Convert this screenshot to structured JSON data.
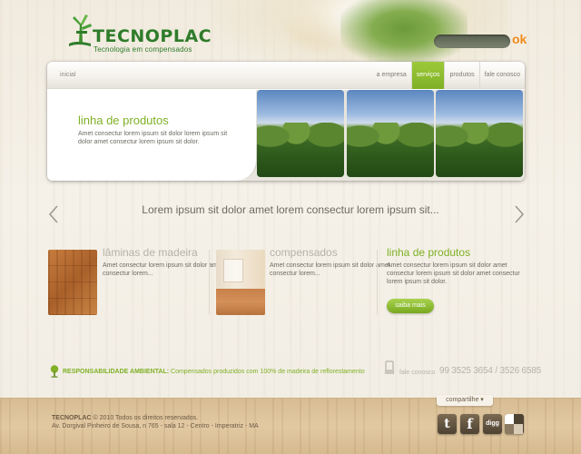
{
  "brand": {
    "name": "TECNOPLAC",
    "tagline": "Tecnologia em compensados"
  },
  "search": {
    "value": "",
    "placeholder": "",
    "button_label": "ok"
  },
  "nav": {
    "home": "inicial",
    "items": [
      {
        "label": "a empresa",
        "active": false
      },
      {
        "label": "serviços",
        "active": true
      },
      {
        "label": "produtos",
        "active": false
      },
      {
        "label": "fale conosco",
        "active": false
      }
    ]
  },
  "hero": {
    "title": "linha de produtos",
    "description": "Amet consectur lorem ipsum sit dolor lorem ipsum sit dolor amet consectur lorem ipsum sit dolor."
  },
  "tagline": "Lorem ipsum sit dolor amet lorem consectur lorem ipsum sit...",
  "columns": [
    {
      "title": "lâminas de madeira",
      "description": "Amet consectur lorem ipsum sit dolor amet consectur lorem..."
    },
    {
      "title": "compensados",
      "description": "Amet consectur lorem ipsum sit dolor amet consectur lorem..."
    },
    {
      "title": "linha de produtos",
      "description": "Amet consectur lorem ipsum sit dolor amet consectur lorem ipsum sit dolor amet consectur lorem ipsum sit dolor.",
      "button_label": "saiba mais"
    }
  ],
  "responsibility": {
    "label": "RESPONSABILIDADE AMBIENTAL:",
    "text": "Compensados produzidos com 100% de madeira de reflorestamento"
  },
  "contact": {
    "label": "fale conosco",
    "phones": "99 3525 3654 / 3526 6585"
  },
  "footer": {
    "brand": "TECNOPLAC",
    "copyright": "2010 Todos os direitos reservados.",
    "address": "Av. Dorgival Pinheiro de Sousa, n 765 - sala 12 - Centro - Imperatriz - MA",
    "share_label": "compartilhe ▾"
  },
  "social": {
    "twitter": "t",
    "facebook": "f",
    "digg": "digg"
  },
  "colors": {
    "accent_green": "#7fb025",
    "logo_green": "#2f7c2a",
    "search_ok": "#f08c1a"
  }
}
